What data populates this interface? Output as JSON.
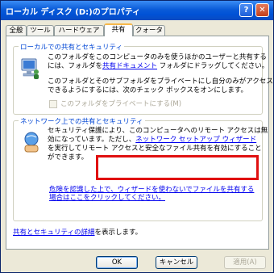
{
  "window": {
    "title": "ローカル ディスク (D:)のプロパティ",
    "help_label": "?",
    "close_label": "✕"
  },
  "tabs": [
    {
      "label": "全般"
    },
    {
      "label": "ツール"
    },
    {
      "label": "ハードウェア"
    },
    {
      "label": "共有"
    },
    {
      "label": "クォータ"
    }
  ],
  "local_group": {
    "title": "ローカルでの共有とセキュリティ",
    "line1": "このフォルダをこのコンピュータのみを使うほかのユーザーと共有する",
    "line2_pre": "には、フォルダを",
    "line2_link": "共有ドキュメント",
    "line2_post": " フォルダにドラッグしてください。",
    "line3": "このフォルダとそのサブフォルダをプライベートにし自分のみがアクセス",
    "line4": "できるようにするには、次のチェック ボックスをオンにします。",
    "private_checkbox": "このフォルダをプライベートにする(M)"
  },
  "network_group": {
    "title": "ネットワーク上での共有とセキュリティ",
    "line1": "セキュリティ保護により、このコンピュータへのリモート アクセスは無",
    "line2_pre": "効になっています。ただし、",
    "line2_link": "ネットワーク セットアップ ウィザード",
    "line3": "を実行してリモート アクセスと安全なファイル共有を有効にすること",
    "line4": "ができます。",
    "risk_link_1": "危険を認識した上で、ウィザードを使わないでファイルを共有する",
    "risk_link_2": "場合はここをクリックしてください。"
  },
  "details": {
    "link": "共有とセキュリティの詳細",
    "suffix": "を表示します。"
  },
  "buttons": {
    "ok": "OK",
    "cancel": "キャンセル",
    "apply": "適用(A)"
  }
}
